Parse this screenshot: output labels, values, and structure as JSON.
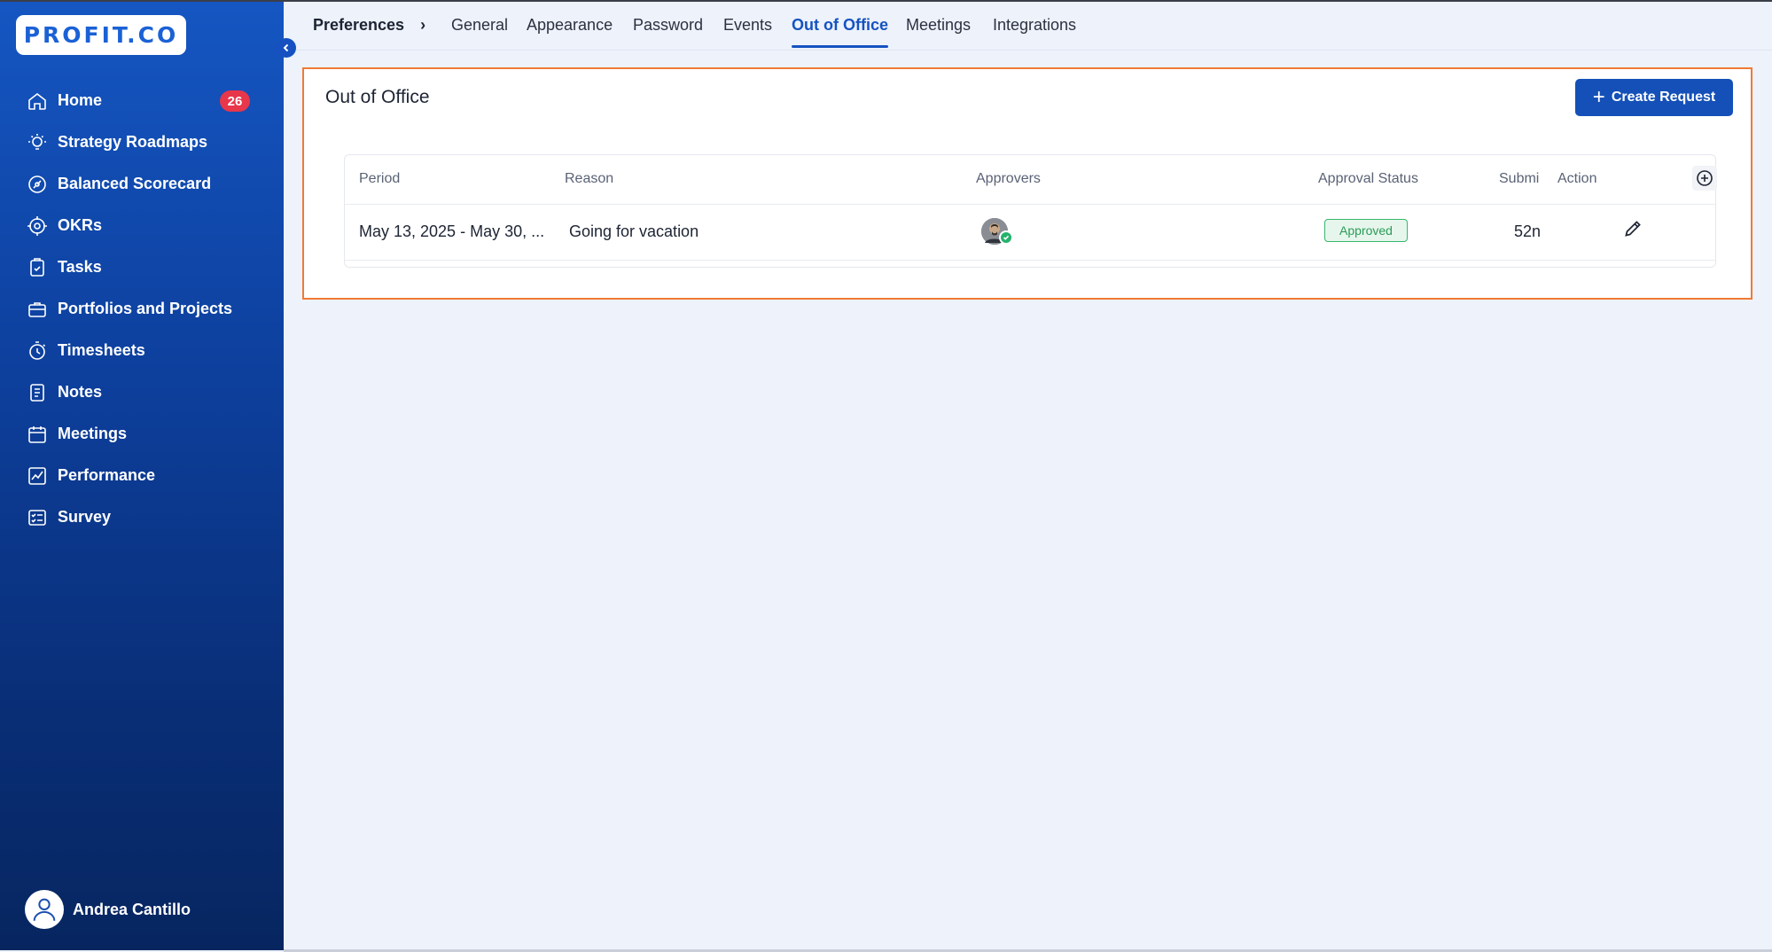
{
  "app": {
    "logo_text": "PROFIT.CO"
  },
  "sidebar": {
    "items": [
      {
        "label": "Home",
        "icon": "home-icon",
        "badge": "26"
      },
      {
        "label": "Strategy Roadmaps",
        "icon": "lightbulb-icon"
      },
      {
        "label": "Balanced Scorecard",
        "icon": "scorecard-icon"
      },
      {
        "label": "OKRs",
        "icon": "target-icon"
      },
      {
        "label": "Tasks",
        "icon": "clipboard-check-icon"
      },
      {
        "label": "Portfolios and Projects",
        "icon": "briefcase-icon"
      },
      {
        "label": "Timesheets",
        "icon": "stopwatch-icon"
      },
      {
        "label": "Notes",
        "icon": "notes-icon"
      },
      {
        "label": "Meetings",
        "icon": "calendar-icon"
      },
      {
        "label": "Performance",
        "icon": "performance-chart-icon"
      },
      {
        "label": "Survey",
        "icon": "survey-icon"
      }
    ],
    "user": {
      "name": "Andrea Cantillo"
    }
  },
  "header": {
    "breadcrumb": "Preferences",
    "tabs": [
      "General",
      "Appearance",
      "Password",
      "Events",
      "Out of Office",
      "Meetings",
      "Integrations"
    ],
    "active_tab": "Out of Office"
  },
  "card": {
    "title": "Out of Office",
    "create_label": "Create Request",
    "columns": [
      "Period",
      "Reason",
      "Approvers",
      "Approval Status",
      "Submi",
      "Action"
    ],
    "rows": [
      {
        "period": "May 13, 2025 - May 30, ...",
        "reason": "Going for vacation",
        "status": "Approved",
        "submitted": "52n"
      }
    ]
  },
  "colors": {
    "accent": "#1553c0",
    "highlight_border": "#f07a35",
    "badge": "#e8364a",
    "approved": "#2a9b57"
  }
}
